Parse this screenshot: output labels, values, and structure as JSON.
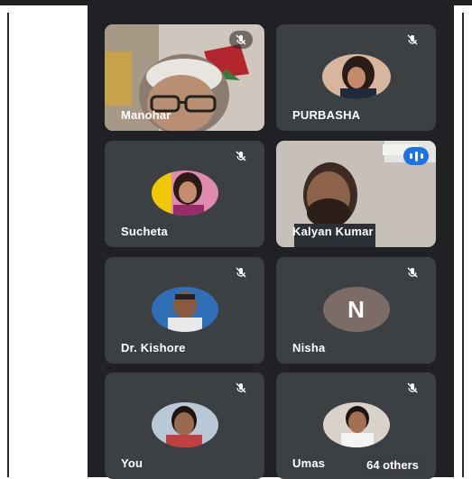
{
  "participants": [
    {
      "name": "Manohar",
      "muted": true,
      "tile": "video",
      "avatar_icon": "elderly-man-glasses-video"
    },
    {
      "name": "PURBASHA",
      "muted": true,
      "tile": "avatar",
      "avatar_icon": "woman-photo-avatar"
    },
    {
      "name": "Sucheta",
      "muted": true,
      "tile": "avatar",
      "avatar_icon": "woman-photo-avatar"
    },
    {
      "name": "Kalyan Kumar",
      "muted": false,
      "speaking": true,
      "tile": "video",
      "avatar_icon": "bearded-man-video"
    },
    {
      "name": "Dr. Kishore",
      "muted": true,
      "tile": "avatar",
      "avatar_icon": "man-photo-avatar"
    },
    {
      "name": "Nisha",
      "muted": true,
      "tile": "letter",
      "avatar_letter": "N"
    },
    {
      "name": "You",
      "muted": true,
      "tile": "avatar",
      "avatar_icon": "man-photo-avatar"
    },
    {
      "name": "Umas",
      "muted": true,
      "tile": "avatar",
      "avatar_icon": "man-photo-avatar"
    }
  ],
  "others_label": "64 others",
  "colors": {
    "background": "#202124",
    "tile": "#3c4043",
    "speaking_accent": "#1a73e8",
    "letter_avatar": "#7d6b66"
  }
}
